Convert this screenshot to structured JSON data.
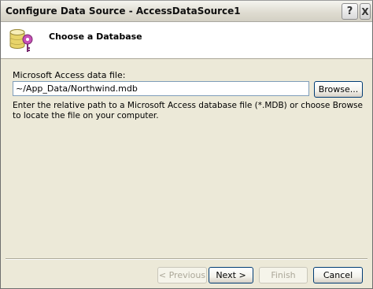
{
  "window": {
    "title": "Configure Data Source - AccessDataSource1",
    "help_label": "?",
    "close_label": "X"
  },
  "header": {
    "title": "Choose a Database",
    "icon": "database-key-icon"
  },
  "form": {
    "label": "Microsoft Access data file:",
    "path_value": "~/App_Data/Northwind.mdb",
    "browse_label": "Browse...",
    "help_text": "Enter the relative path to a Microsoft Access database file (*.MDB) or choose Browse to locate the file on your computer."
  },
  "footer": {
    "previous_label": "< Previous",
    "next_label": "Next >",
    "finish_label": "Finish",
    "cancel_label": "Cancel"
  }
}
